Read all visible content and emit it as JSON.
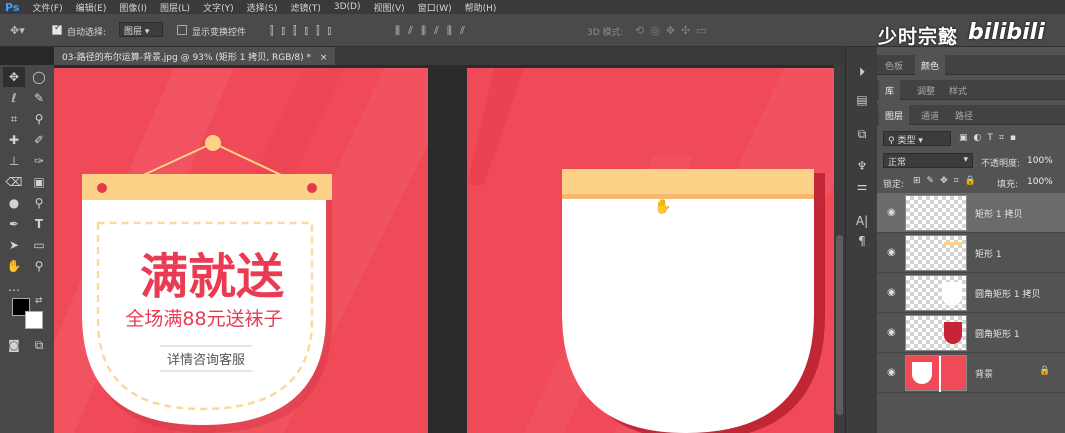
{
  "app": {
    "logo": "Ps"
  },
  "menu": [
    "文件(F)",
    "编辑(E)",
    "图像(I)",
    "图层(L)",
    "文字(Y)",
    "选择(S)",
    "滤镜(T)",
    "3D(D)",
    "视图(V)",
    "窗口(W)",
    "帮助(H)"
  ],
  "options_bar": {
    "auto_select_label": "自动选择:",
    "auto_select_value": "图层",
    "show_transform_label": "显示变换控件",
    "mode_3d_label": "3D 模式:"
  },
  "document": {
    "tab_title": "03-路径的布尔运算-背景.jpg @ 93% (矩形 1 拷贝, RGB/8) *"
  },
  "artwork": {
    "headline": "满就送",
    "subline": "全场满88元送袜子",
    "button": "详情咨询客服",
    "colors": {
      "bg": "#f04a58",
      "banner": "#fdd188",
      "dot": "#e23b4c",
      "text": "#e93c52"
    }
  },
  "watermark": {
    "text": "少时宗懿",
    "logo": "bilibili"
  },
  "panels": {
    "tabs_row1": [
      "色板",
      "颜色"
    ],
    "tabs_row2": [
      "库",
      "调整",
      "样式"
    ],
    "tabs_row3": [
      "图层",
      "通道",
      "路径"
    ],
    "kind_filter": "类型",
    "blend_mode": "正常",
    "opacity_label": "不透明度:",
    "opacity_value": "100%",
    "lock_label": "锁定:",
    "fill_label": "填充:",
    "fill_value": "100%",
    "layers": [
      {
        "name": "矩形 1 拷贝",
        "selected": true
      },
      {
        "name": "矩形 1",
        "selected": false
      },
      {
        "name": "圆角矩形 1 拷贝",
        "selected": false
      },
      {
        "name": "圆角矩形 1",
        "selected": false
      },
      {
        "name": "背景",
        "selected": false,
        "locked": true
      }
    ]
  }
}
